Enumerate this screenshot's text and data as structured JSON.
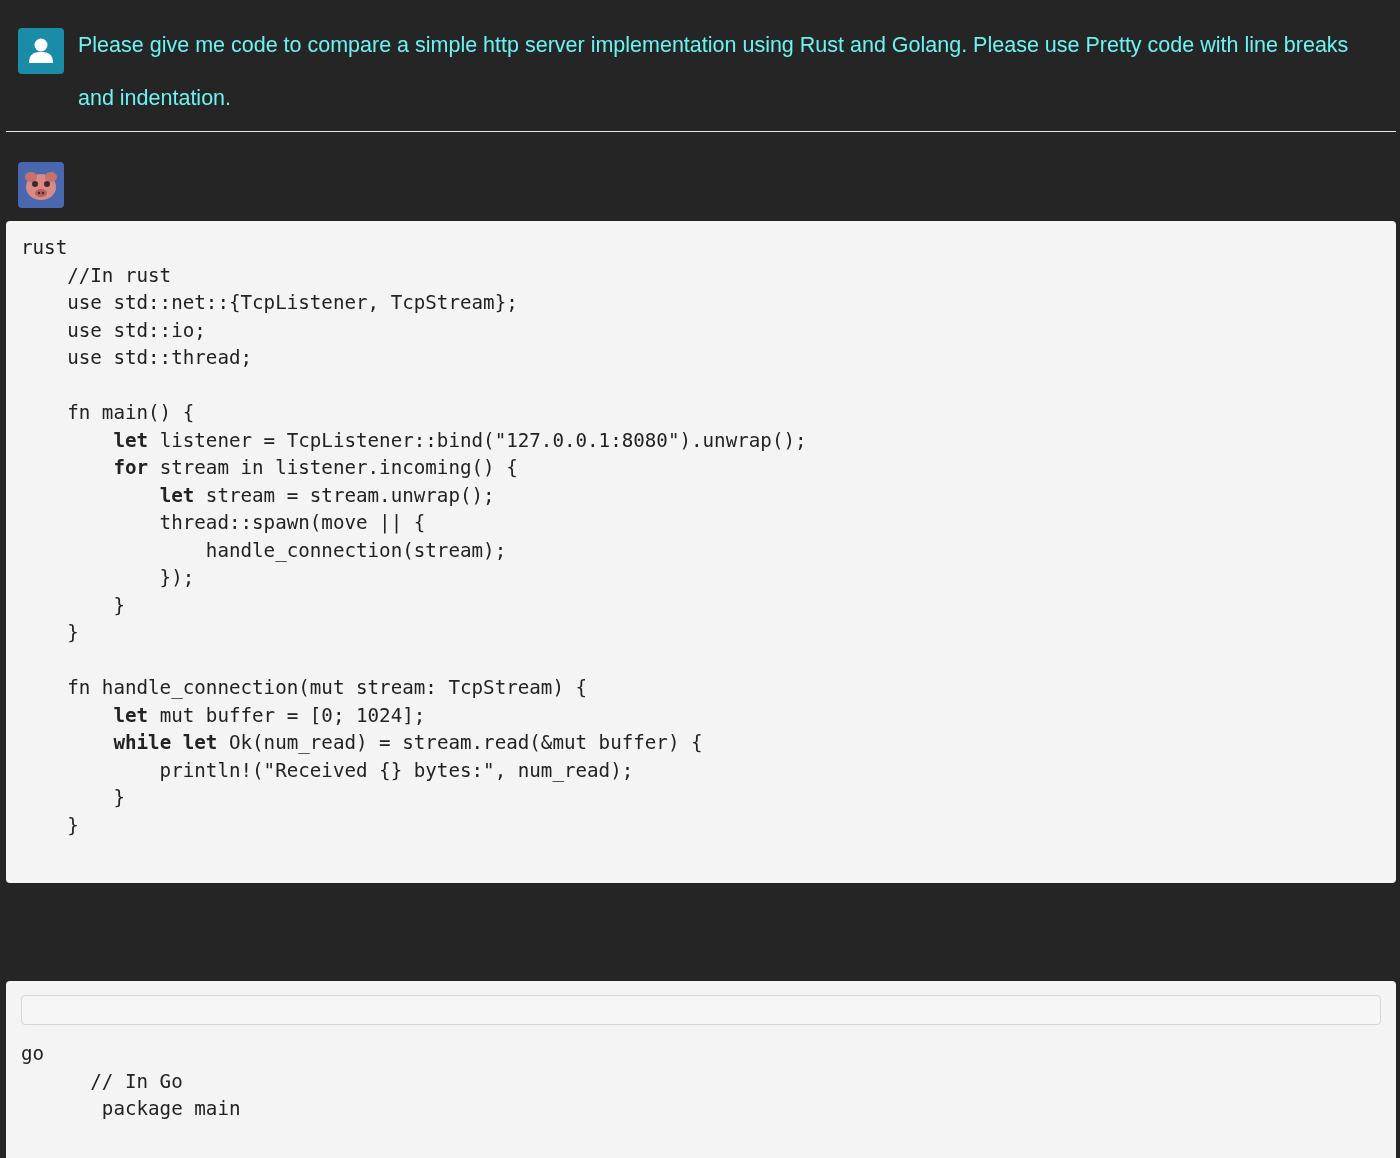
{
  "prompt": {
    "text": "Please give me code to compare a simple http server implementation using Rust and Golang. Please use Pretty code with line breaks and indentation."
  },
  "responses": [
    {
      "toolbar": false,
      "language": "rust",
      "sections": [
        [
          "    //In rust",
          "    use std::net::{TcpListener, TcpStream};",
          "    use std::io;",
          "    use std::thread;"
        ],
        [
          "    fn main() {",
          "        **let** listener = TcpListener::bind(\"127.0.0.1:8080\").unwrap();",
          "        **for** stream in listener.incoming() {",
          "            **let** stream = stream.unwrap();",
          "            thread::spawn(move || {",
          "                handle_connection(stream);",
          "            });",
          "        }",
          "    }"
        ],
        [
          "    fn handle_connection(mut stream: TcpStream) {",
          "        **let** mut buffer = [0; 1024];",
          "        **while let** Ok(num_read) = stream.read(&mut buffer) {",
          "            println!(\"Received {} bytes:\", num_read);",
          "        }",
          "    }"
        ]
      ]
    },
    {
      "toolbar": true,
      "language": "go",
      "sections": [
        [
          "      // In Go",
          "       package main"
        ]
      ]
    }
  ]
}
